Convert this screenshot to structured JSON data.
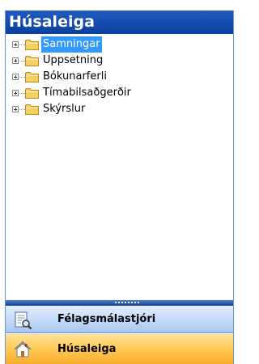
{
  "header": {
    "title": "Húsaleiga"
  },
  "tree": {
    "items": [
      {
        "label": "Samningar",
        "icon": "folder-icon",
        "selected": true
      },
      {
        "label": "Uppsetning",
        "icon": "folder-icon",
        "selected": false
      },
      {
        "label": "Bókunarferli",
        "icon": "folder-icon",
        "selected": false
      },
      {
        "label": "Tímabilsaðgerðir",
        "icon": "folder-icon",
        "selected": false
      },
      {
        "label": "Skýrslur",
        "icon": "folder-icon",
        "selected": false
      }
    ]
  },
  "nav": {
    "buttons": [
      {
        "label": "Félagsmálastjóri",
        "icon": "document-magnifier-icon",
        "active": false
      },
      {
        "label": "Húsaleiga",
        "icon": "house-icon",
        "active": true
      }
    ]
  },
  "colors": {
    "header": "#1f5cc1",
    "selection": "#3399ff",
    "nav_active": "#ffcc5a",
    "nav_inactive": "#c3d9f9",
    "folder": "#f4cf63"
  }
}
